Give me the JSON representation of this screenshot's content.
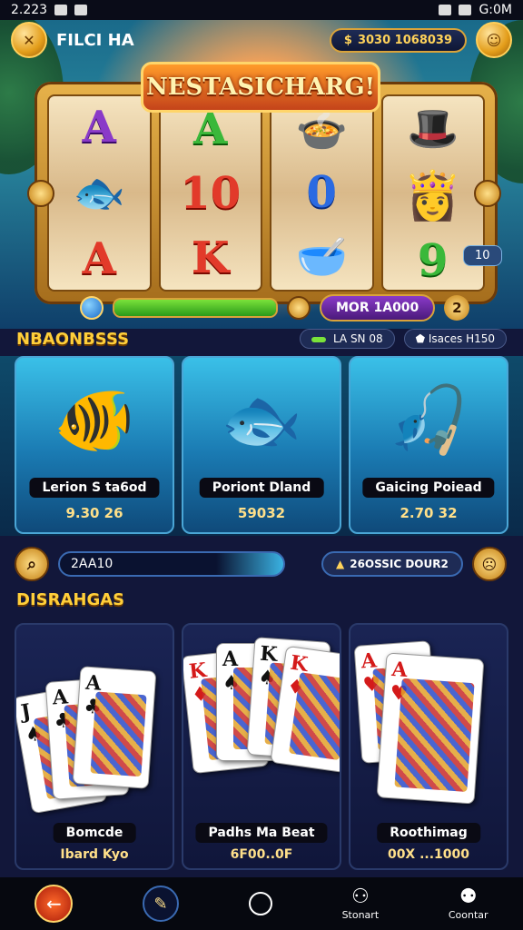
{
  "status": {
    "time": "2.223",
    "right": "G:0M"
  },
  "header": {
    "player_name": "FILCI HA",
    "balance": "3030 1068039"
  },
  "slot": {
    "title": "NESTASICHARG!",
    "reels": [
      [
        "A",
        "A"
      ],
      [
        "10",
        "K"
      ],
      [
        "0",
        ""
      ],
      [
        "",
        "9"
      ]
    ],
    "progress": 1.0,
    "more_label": "MOR 1A000",
    "level_badge": "2",
    "side_chip": "10"
  },
  "fishing": {
    "section_title": "NBAONBSSS",
    "chip_left": "LA SN 08",
    "chip_right": "Isaces H150",
    "cards": [
      {
        "label": "Lerion S ta6od",
        "value": "9.30 26"
      },
      {
        "label": "Poriont Dland",
        "value": "59032"
      },
      {
        "label": "Gaicing Poiead",
        "value": "2.70 32"
      }
    ]
  },
  "search": {
    "value": "2AA10",
    "jackpot": "26OSSIC DOUR2"
  },
  "cards_section": {
    "title": "DISRAHGAS",
    "panels": [
      {
        "label": "Bomcde",
        "sub": "Ibard Kyo"
      },
      {
        "label": "Padhs Ma Beat",
        "sub": "6F00..0F"
      },
      {
        "label": "Roothimag",
        "sub": "00X ...1000"
      }
    ]
  },
  "nav": {
    "item4": "Stonart",
    "item5": "Coontar"
  }
}
